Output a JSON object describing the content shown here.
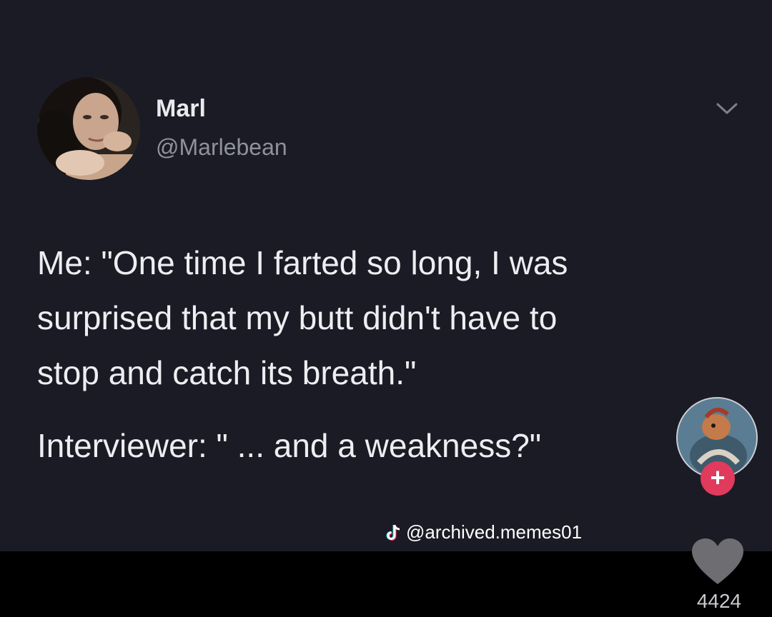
{
  "tweet": {
    "display_name": "Marl",
    "handle": "@Marlebean",
    "text_lines": [
      "Me: \"One time I farted so long, I was",
      "surprised that my butt didn't have to",
      "stop and catch its breath.\""
    ],
    "interviewer_line": "Interviewer: \" ... and a weakness?\"",
    "menu_icon": "chevron-down-icon",
    "avatar_icon": "profile-photo"
  },
  "overlay": {
    "watermark": "@archived.memes01",
    "watermark_icon": "tiktok-logo-icon",
    "follow_label": "+",
    "like_count": "4424",
    "like_icon": "heart-icon"
  },
  "colors": {
    "card_background": "#1b1b25",
    "text": "#eeeef2",
    "handle": "#8f929b",
    "follow_accent": "#e03a5c",
    "page_background": "#000000"
  }
}
